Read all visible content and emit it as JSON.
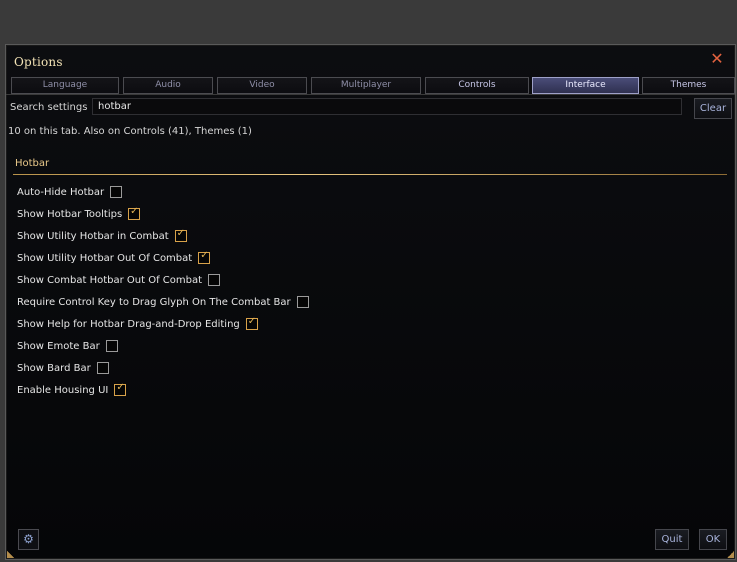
{
  "window": {
    "title": "Options"
  },
  "tabs": [
    {
      "label": "Language"
    },
    {
      "label": "Audio"
    },
    {
      "label": "Video"
    },
    {
      "label": "Multiplayer"
    },
    {
      "label": "Controls"
    },
    {
      "label": "Interface"
    },
    {
      "label": "Themes"
    }
  ],
  "active_tab": "Interface",
  "search": {
    "label": "Search settings",
    "value": "hotbar",
    "clear_label": "Clear",
    "results_text": "10 on this tab. Also on Controls (41), Themes (1)"
  },
  "section": {
    "title": "Hotbar"
  },
  "settings": [
    {
      "label": "Auto-Hide Hotbar",
      "checked": false
    },
    {
      "label": "Show Hotbar Tooltips",
      "checked": true
    },
    {
      "label": "Show Utility Hotbar in Combat",
      "checked": true
    },
    {
      "label": "Show Utility Hotbar Out Of Combat",
      "checked": true
    },
    {
      "label": "Show Combat Hotbar Out Of Combat",
      "checked": false
    },
    {
      "label": "Require Control Key to Drag Glyph On The Combat Bar",
      "checked": false
    },
    {
      "label": "Show Help for Hotbar Drag-and-Drop Editing",
      "checked": true
    },
    {
      "label": "Show Emote Bar",
      "checked": false
    },
    {
      "label": "Show Bard Bar",
      "checked": false
    },
    {
      "label": "Enable Housing UI",
      "checked": true
    }
  ],
  "footer": {
    "quit_label": "Quit",
    "ok_label": "OK",
    "icon": "gear-icon"
  },
  "colors": {
    "accent": "#e9c98a",
    "close": "#e2623f",
    "active_tab": "#4a4d78"
  }
}
